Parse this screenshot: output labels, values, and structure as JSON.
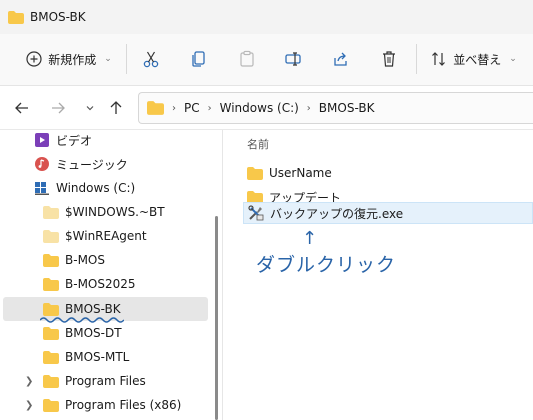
{
  "window": {
    "title": "BMOS-BK"
  },
  "toolbar": {
    "new_label": "新規作成",
    "sort_label": "並べ替え",
    "icons": [
      "cut-icon",
      "copy-icon",
      "paste-icon",
      "rename-icon",
      "share-icon",
      "delete-icon"
    ]
  },
  "address": {
    "crumbs": [
      "PC",
      "Windows (C:)",
      "BMOS-BK"
    ]
  },
  "sidebar": {
    "items": [
      {
        "label": "ビデオ",
        "icon": "video-icon"
      },
      {
        "label": "ミュージック",
        "icon": "music-icon"
      },
      {
        "label": "Windows (C:)",
        "icon": "drive-icon"
      },
      {
        "label": "$WINDOWS.~BT",
        "icon": "folder-icon"
      },
      {
        "label": "$WinREAgent",
        "icon": "folder-icon"
      },
      {
        "label": "B-MOS",
        "icon": "folder-icon"
      },
      {
        "label": "B-MOS2025",
        "icon": "folder-icon"
      },
      {
        "label": "BMOS-BK",
        "icon": "folder-icon",
        "selected": true
      },
      {
        "label": "BMOS-DT",
        "icon": "folder-icon"
      },
      {
        "label": "BMOS-MTL",
        "icon": "folder-icon"
      },
      {
        "label": "Program Files",
        "icon": "folder-icon",
        "expandable": true
      },
      {
        "label": "Program Files (x86)",
        "icon": "folder-icon",
        "expandable": true
      }
    ]
  },
  "content": {
    "column_name": "名前",
    "files": [
      {
        "name": "UserName",
        "icon": "folder-icon"
      },
      {
        "name": "アップデート",
        "icon": "folder-icon"
      },
      {
        "name": "バックアップの復元.exe",
        "icon": "tools-icon",
        "highlight": true
      }
    ]
  },
  "annotation": {
    "arrow": "↑",
    "text": "ダブルクリック",
    "color": "#2a64a8"
  },
  "colors": {
    "folder": "#f8c84a",
    "selection": "#e6e6e6",
    "highlight": "#e5f1fb"
  }
}
